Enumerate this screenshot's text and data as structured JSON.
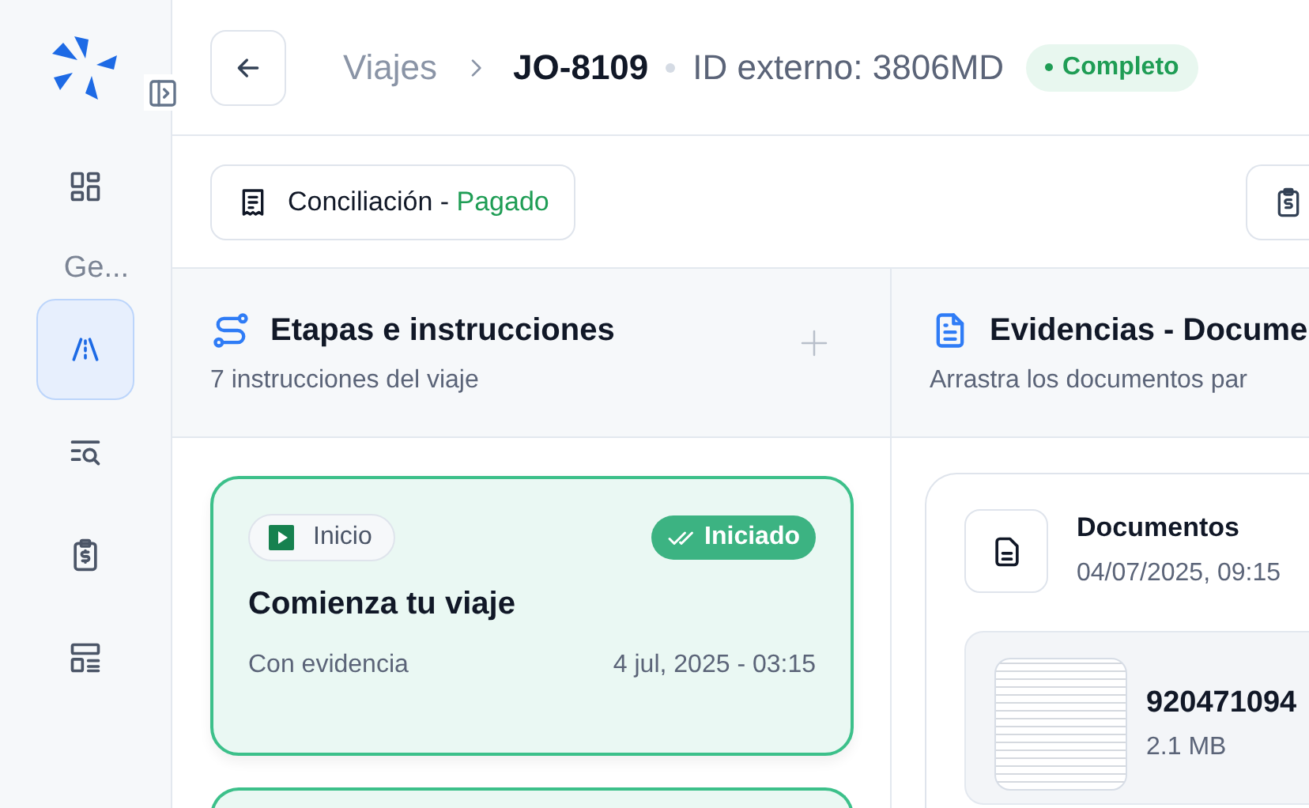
{
  "sidebar": {
    "items": [
      {
        "kind": "icon",
        "selected": false
      },
      {
        "kind": "section",
        "label": "Ge..."
      },
      {
        "kind": "icon",
        "selected": true
      },
      {
        "kind": "icon",
        "selected": false
      },
      {
        "kind": "icon",
        "selected": false
      },
      {
        "kind": "icon",
        "selected": false
      }
    ]
  },
  "header": {
    "breadcrumb": "Viajes",
    "title": "JO-8109",
    "external_id": "ID externo: 3806MD",
    "status": "Completo"
  },
  "toolbar": {
    "reconciliation": {
      "label": "Conciliación - ",
      "status": "Pagado"
    }
  },
  "stages": {
    "title": "Etapas e instrucciones",
    "subtitle": "7 instrucciones del viaje",
    "cards": [
      {
        "tag": "Inicio",
        "status": "Iniciado",
        "started": true,
        "title": "Comienza tu viaje",
        "evidence": "Con evidencia",
        "date": "4 jul, 2025 - 03:15"
      }
    ]
  },
  "evidence": {
    "title": "Evidencias - Docume",
    "subtitle": "Arrastra los documentos par",
    "group": {
      "title": "Documentos",
      "date": "04/07/2025, 09:15",
      "files": [
        {
          "name": "920471094",
          "size": "2.1 MB"
        }
      ]
    }
  }
}
